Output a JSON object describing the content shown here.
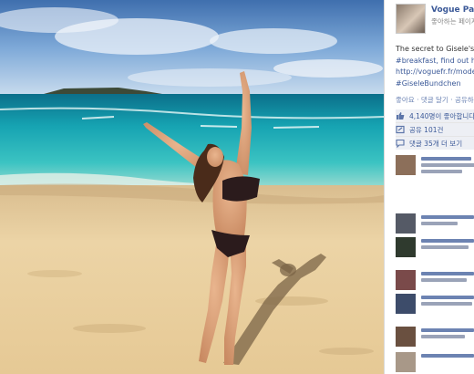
{
  "post": {
    "page_name": "Vogue Pari",
    "like_label": "좋아하는 페이지",
    "caption_line1": "The secret to Gisele's c",
    "caption_line2": "#breakfast, find out ho",
    "caption_link": "http://voguefr.fr/mode",
    "caption_hashtag": "#GiseleBundchen"
  },
  "actions": {
    "text": "좋아요 · 댓글 달기 · 공유하"
  },
  "stats": {
    "likes": "4,140명이 좋아합니다",
    "shares": "공유 101건",
    "comments": "댓글 35개 더 보기"
  },
  "colors": {
    "link": "#3b5998",
    "sea": "#1fa9b4",
    "sand": "#e9cf9e",
    "sky": "#7aa7d6"
  },
  "icons": [
    "thumbs-up-icon",
    "share-icon",
    "comment-icon"
  ]
}
